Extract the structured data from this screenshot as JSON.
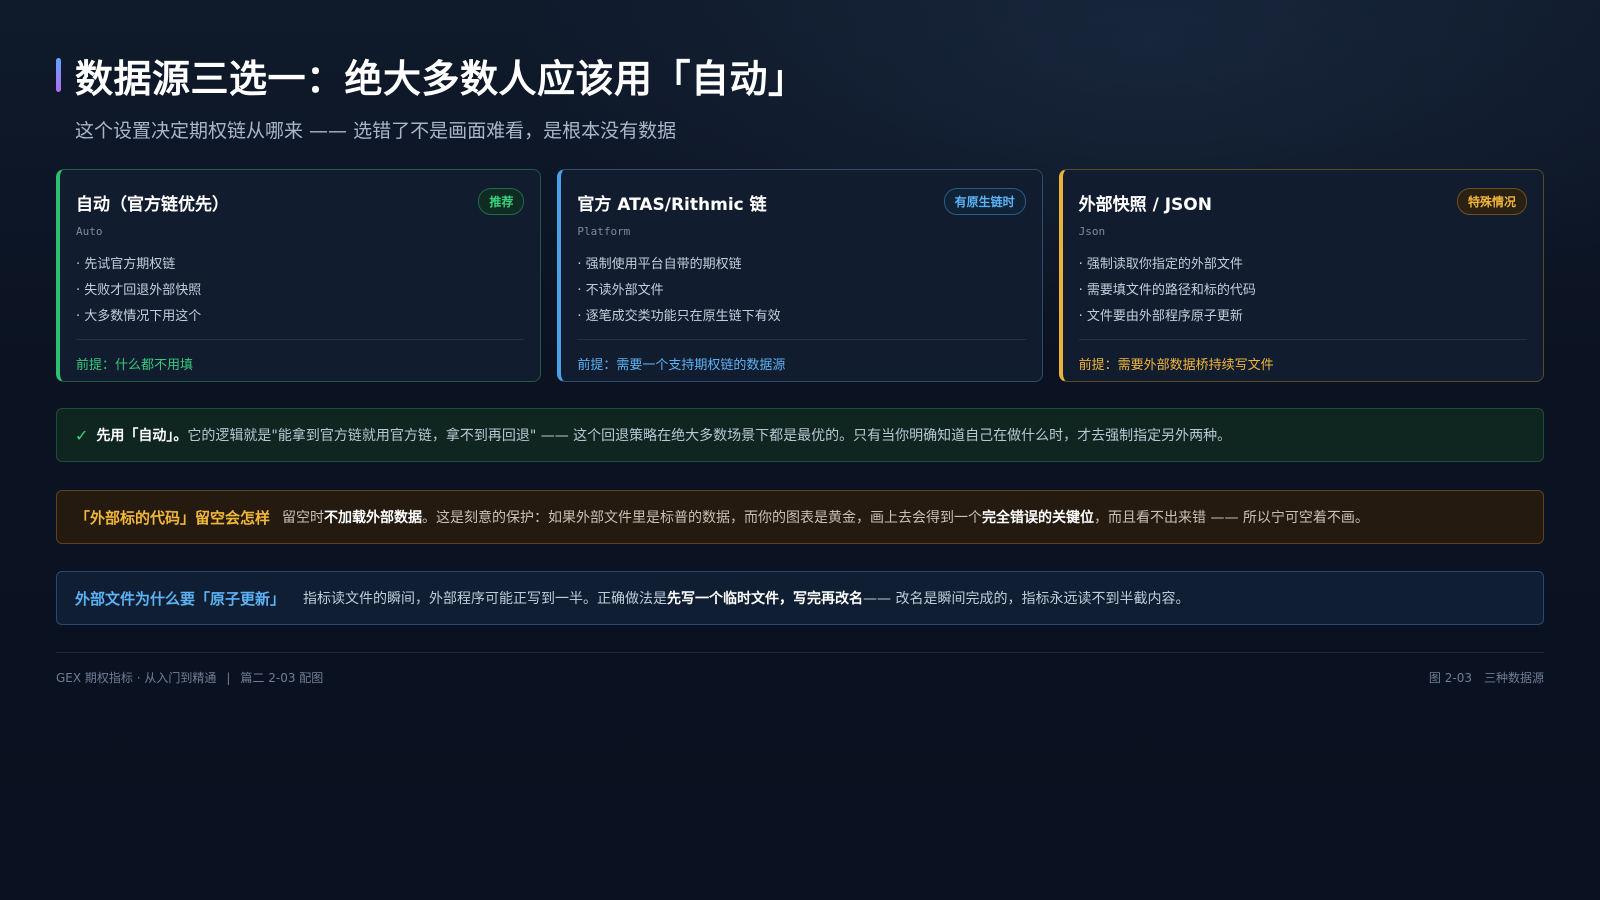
{
  "header": {
    "title": "数据源三选一：绝大多数人应该用「自动」",
    "subtitle": "这个设置决定期权链从哪来 —— 选错了不是画面难看，是根本没有数据"
  },
  "cards": [
    {
      "title": "自动（官方链优先）",
      "badge": "推荐",
      "code": "Auto",
      "items": [
        "· 先试官方期权链",
        "· 失败才回退外部快照",
        "· 大多数情况下用这个"
      ],
      "note": "前提：什么都不用填"
    },
    {
      "title": "官方 ATAS/Rithmic 链",
      "badge": "有原生链时",
      "code": "Platform",
      "items": [
        "· 强制使用平台自带的期权链",
        "· 不读外部文件",
        "· 逐笔成交类功能只在原生链下有效"
      ],
      "note": "前提：需要一个支持期权链的数据源"
    },
    {
      "title": "外部快照 / JSON",
      "badge": "特殊情况",
      "code": "Json",
      "items": [
        "· 强制读取你指定的外部文件",
        "· 需要填文件的路径和标的代码",
        "· 文件要由外部程序原子更新"
      ],
      "note": "前提：需要外部数据桥持续写文件"
    }
  ],
  "callouts": {
    "recommend": {
      "icon": "✓",
      "lead": "先用「自动」。",
      "body": "它的逻辑就是\"能拿到官方链就用官方链，拿不到再回退\" —— 这个回退策略在绝大多数场景下都是最优的。只有当你明确知道自己在做什么时，才去强制指定另外两种。"
    },
    "warning": {
      "label": "「外部标的代码」留空会怎样",
      "p1": "留空时",
      "b1": "不加载外部数据",
      "p2": "。这是刻意的保护：如果外部文件里是标普的数据，而你的图表是黄金，画上去会得到一个",
      "b2": "完全错误的关键位",
      "p3": "，而且看不出来错 —— 所以宁可空着不画。"
    },
    "info": {
      "label": "外部文件为什么要「原子更新」",
      "p1": "指标读文件的瞬间，外部程序可能正写到一半。正确做法是",
      "b1": "先写一个临时文件，写完再改名",
      "p2": " —— 改名是瞬间完成的，指标永远读不到半截内容。"
    }
  },
  "footer": {
    "series": "GEX 期权指标 · 从入门到精通",
    "divider": "|",
    "chapter": "篇二 2-03 配图",
    "figure_no": "图 2-03",
    "figure_name": "三种数据源"
  },
  "colors": {
    "green": "#2fbf71",
    "blue": "#4aa3e8",
    "amber": "#e8b23c",
    "background": "#0b1322"
  }
}
